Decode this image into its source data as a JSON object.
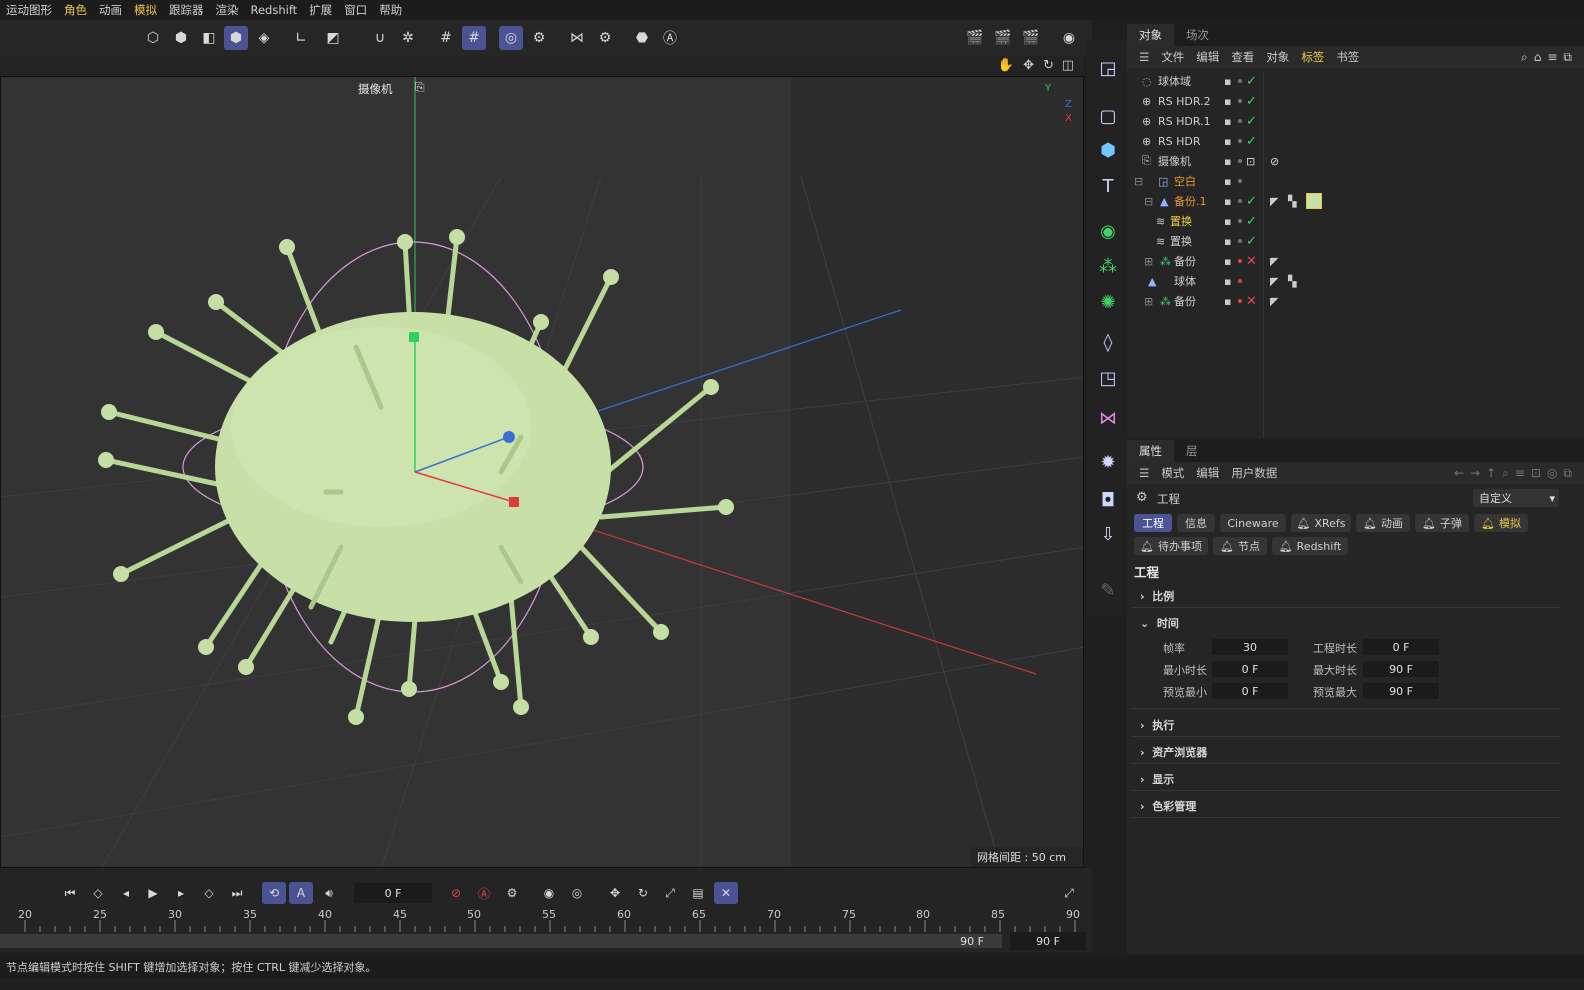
{
  "menubar": {
    "items": [
      "运动图形",
      "角色",
      "动画",
      "模拟",
      "跟踪器",
      "渲染",
      "Redshift",
      "扩展",
      "窗口",
      "帮助"
    ],
    "highlighted": [
      "角色",
      "模拟"
    ]
  },
  "viewport": {
    "camera_label": "摄像机",
    "grid_spacing": "网格间距 : 50 cm",
    "axis_y": "Y",
    "axis_z": "Z",
    "axis_x": "X"
  },
  "object_manager": {
    "tabs": [
      "对象",
      "场次"
    ],
    "menu": [
      "文件",
      "编辑",
      "查看",
      "对象",
      "标签",
      "书签"
    ],
    "objects": [
      {
        "name": "球体域",
        "style": "normal",
        "state": "check"
      },
      {
        "name": "RS HDR.2",
        "style": "normal",
        "state": "check"
      },
      {
        "name": "RS HDR.1",
        "style": "normal",
        "state": "check"
      },
      {
        "name": "RS HDR",
        "style": "normal",
        "state": "check"
      },
      {
        "name": "摄像机",
        "style": "normal",
        "state": "target"
      },
      {
        "name": "空白",
        "style": "orange",
        "state": "none"
      },
      {
        "name": "备份.1",
        "style": "orange",
        "state": "check"
      },
      {
        "name": "置换",
        "style": "yellow",
        "state": "check"
      },
      {
        "name": "置换",
        "style": "normal",
        "state": "check"
      },
      {
        "name": "备份",
        "style": "normal",
        "state": "x"
      },
      {
        "name": "球体",
        "style": "normal",
        "state": "none"
      },
      {
        "name": "备份",
        "style": "normal",
        "state": "x"
      }
    ]
  },
  "attributes": {
    "tabs": [
      "属性",
      "层"
    ],
    "menu": [
      "模式",
      "编辑",
      "用户数据"
    ],
    "header": "工程",
    "preset": "自定义",
    "pill_tabs_row1": [
      "工程",
      "信息",
      "Cineware",
      "XRefs",
      "动画",
      "子弹",
      "模拟"
    ],
    "pill_tabs_row2": [
      "待办事项",
      "节点",
      "Redshift"
    ],
    "section_title": "工程",
    "sections": {
      "scale": "比例",
      "time": "时间",
      "exec": "执行",
      "asset": "资产浏览器",
      "display": "显示",
      "color": "色彩管理"
    },
    "fields": {
      "fps_label": "帧率",
      "fps": "30",
      "proj_len_label": "工程时长",
      "proj_len": "0 F",
      "min_len_label": "最小时长",
      "min_len": "0 F",
      "max_len_label": "最大时长",
      "max_len": "90 F",
      "prev_min_label": "预览最小",
      "prev_min": "0 F",
      "prev_max_label": "预览最大",
      "prev_max": "90 F"
    }
  },
  "timeline": {
    "current_frame": "0 F",
    "ticks": [
      "20",
      "25",
      "30",
      "35",
      "40",
      "45",
      "50",
      "55",
      "60",
      "65",
      "70",
      "75",
      "80",
      "85",
      "90"
    ],
    "end_frame_a": "90 F",
    "end_frame_b": "90 F"
  },
  "status": "节点编辑模式时按住 SHIFT 键增加选择对象；按住 CTRL 键减少选择对象。",
  "colors": {
    "accent": "#4b5394",
    "highlight": "#e8c84a",
    "check": "#3fd36b",
    "cross": "#e04848",
    "model": "#c5dea4"
  }
}
